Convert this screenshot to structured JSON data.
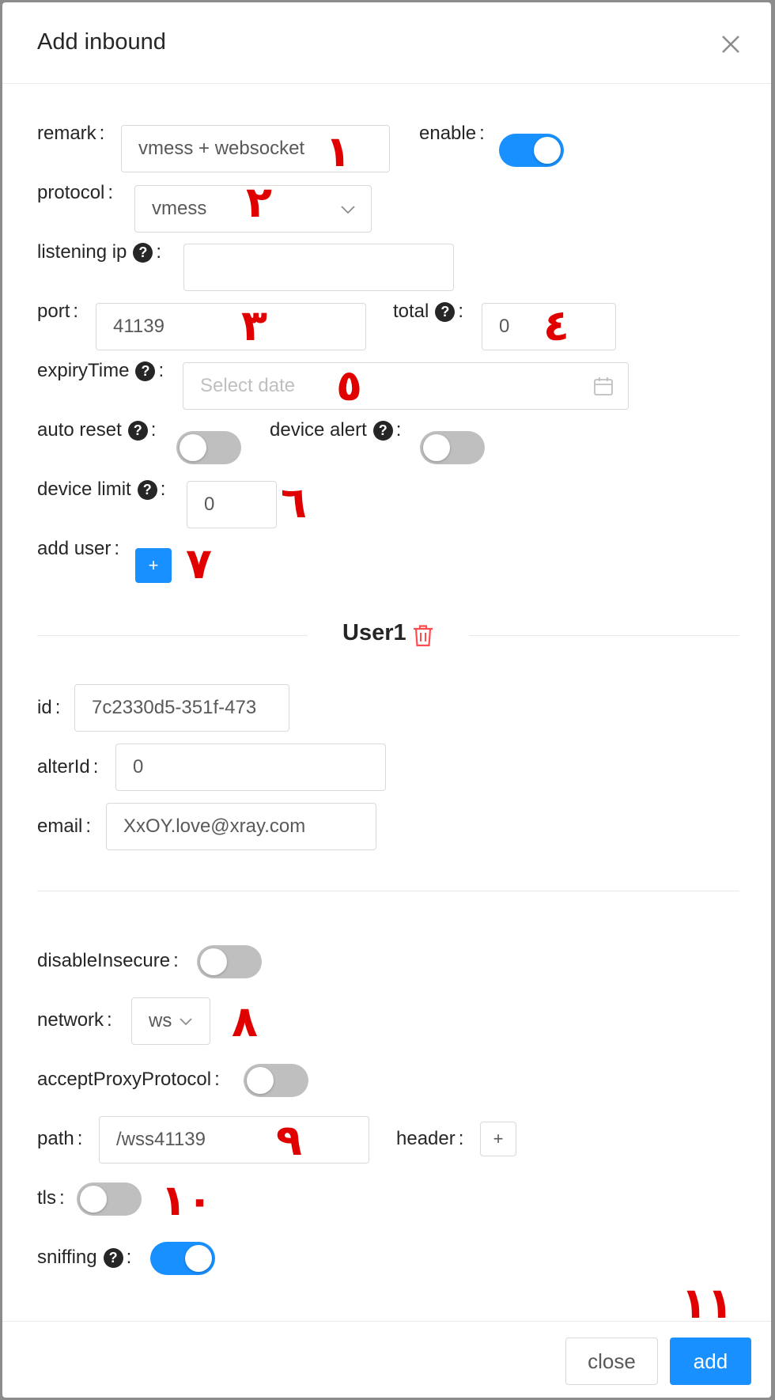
{
  "modal": {
    "title": "Add inbound",
    "close_icon": "close-icon"
  },
  "fields": {
    "remark": {
      "label": "remark",
      "value": "vmess + websocket"
    },
    "enable": {
      "label": "enable",
      "on": true
    },
    "protocol": {
      "label": "protocol",
      "value": "vmess"
    },
    "listening_ip": {
      "label": "listening ip",
      "value": ""
    },
    "port": {
      "label": "port",
      "value": "41139"
    },
    "total": {
      "label": "total",
      "value": "0"
    },
    "expiry_time": {
      "label": "expiryTime",
      "placeholder": "Select date"
    },
    "auto_reset": {
      "label": "auto reset",
      "on": false
    },
    "device_alert": {
      "label": "device alert",
      "on": false
    },
    "device_limit": {
      "label": "device limit",
      "value": "0"
    },
    "add_user": {
      "label": "add user",
      "button": "+"
    }
  },
  "user": {
    "title": "User1",
    "id": {
      "label": "id",
      "value": "7c2330d5-351f-473"
    },
    "alter_id": {
      "label": "alterId",
      "value": "0"
    },
    "email": {
      "label": "email",
      "value": "XxOY.love@xray.com"
    }
  },
  "stream": {
    "disable_insecure": {
      "label": "disableInsecure",
      "on": false
    },
    "network": {
      "label": "network",
      "value": "ws"
    },
    "accept_proxy_protocol": {
      "label": "acceptProxyProtocol",
      "on": false
    },
    "path": {
      "label": "path",
      "value": "/wss41139"
    },
    "header": {
      "label": "header",
      "button": "+"
    },
    "tls": {
      "label": "tls",
      "on": false
    },
    "sniffing": {
      "label": "sniffing",
      "on": true
    }
  },
  "footer": {
    "close_label": "close",
    "add_label": "add"
  },
  "annotations": [
    "١",
    "٢",
    "٣",
    "٤",
    "٥",
    "٦",
    "٧",
    "٨",
    "٩",
    "١٠",
    "١١"
  ],
  "colors": {
    "primary": "#1890ff",
    "annotation": "#e00000",
    "switch_off": "#bfbfbf",
    "delete": "#ff4d4f"
  }
}
